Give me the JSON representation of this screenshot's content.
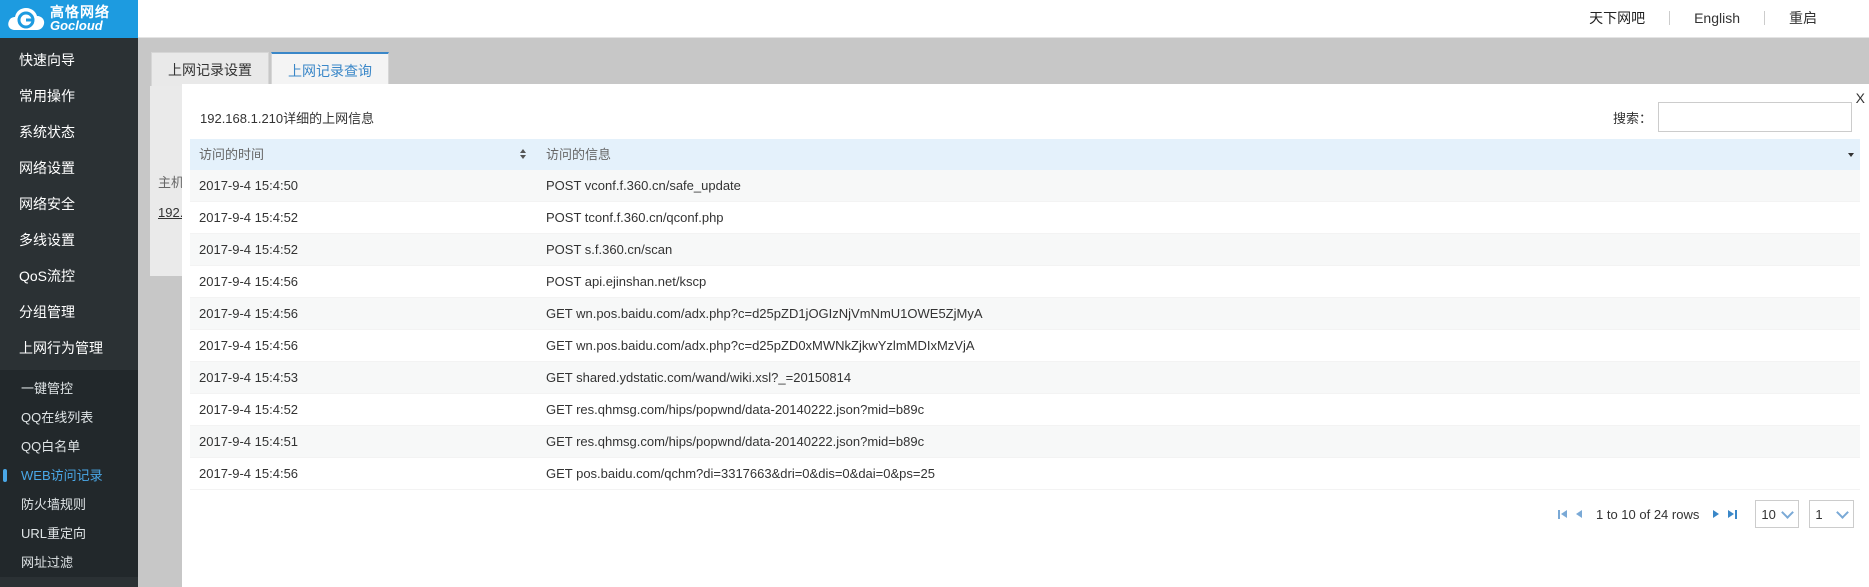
{
  "brand": {
    "name_cn": "高恪网络",
    "name_en": "Gocloud",
    "color": "#1d9be0"
  },
  "top_links": [
    "天下网吧",
    "English",
    "重启"
  ],
  "sidebar": {
    "items": [
      "快速向导",
      "常用操作",
      "系统状态",
      "网络设置",
      "网络安全",
      "多线设置",
      "QoS流控",
      "分组管理",
      "上网行为管理"
    ],
    "sub_items": [
      "一键管控",
      "QQ在线列表",
      "QQ白名单",
      "WEB访问记录",
      "防火墙规则",
      "URL重定向",
      "网址过滤"
    ],
    "active_sub": "WEB访问记录"
  },
  "tabs": [
    {
      "label": "上网记录设置",
      "active": false
    },
    {
      "label": "上网记录查询",
      "active": true
    }
  ],
  "background": {
    "column_label": "主机",
    "link_text": "192."
  },
  "modal": {
    "close_label": "X",
    "title": "192.168.1.210详细的上网信息",
    "search_label": "搜索：",
    "search_value": "",
    "columns": [
      "访问的时间",
      "访问的信息"
    ],
    "rows": [
      {
        "time": "2017-9-4 15:4:50",
        "info": "POST vconf.f.360.cn/safe_update"
      },
      {
        "time": "2017-9-4 15:4:52",
        "info": "POST tconf.f.360.cn/qconf.php"
      },
      {
        "time": "2017-9-4 15:4:52",
        "info": "POST s.f.360.cn/scan"
      },
      {
        "time": "2017-9-4 15:4:56",
        "info": "POST api.ejinshan.net/kscp"
      },
      {
        "time": "2017-9-4 15:4:56",
        "info": "GET wn.pos.baidu.com/adx.php?c=d25pZD1jOGIzNjVmNmU1OWE5ZjMyA"
      },
      {
        "time": "2017-9-4 15:4:56",
        "info": "GET wn.pos.baidu.com/adx.php?c=d25pZD0xMWNkZjkwYzlmMDIxMzVjA"
      },
      {
        "time": "2017-9-4 15:4:53",
        "info": "GET shared.ydstatic.com/wand/wiki.xsl?_=20150814"
      },
      {
        "time": "2017-9-4 15:4:52",
        "info": "GET res.qhmsg.com/hips/popwnd/data-20140222.json?mid=b89c"
      },
      {
        "time": "2017-9-4 15:4:51",
        "info": "GET res.qhmsg.com/hips/popwnd/data-20140222.json?mid=b89c"
      },
      {
        "time": "2017-9-4 15:4:56",
        "info": "GET pos.baidu.com/qchm?di=3317663&dri=0&dis=0&dai=0&ps=25"
      }
    ],
    "pagination": {
      "info": "1 to 10 of 24 rows",
      "page_size": "10",
      "page": "1"
    }
  }
}
